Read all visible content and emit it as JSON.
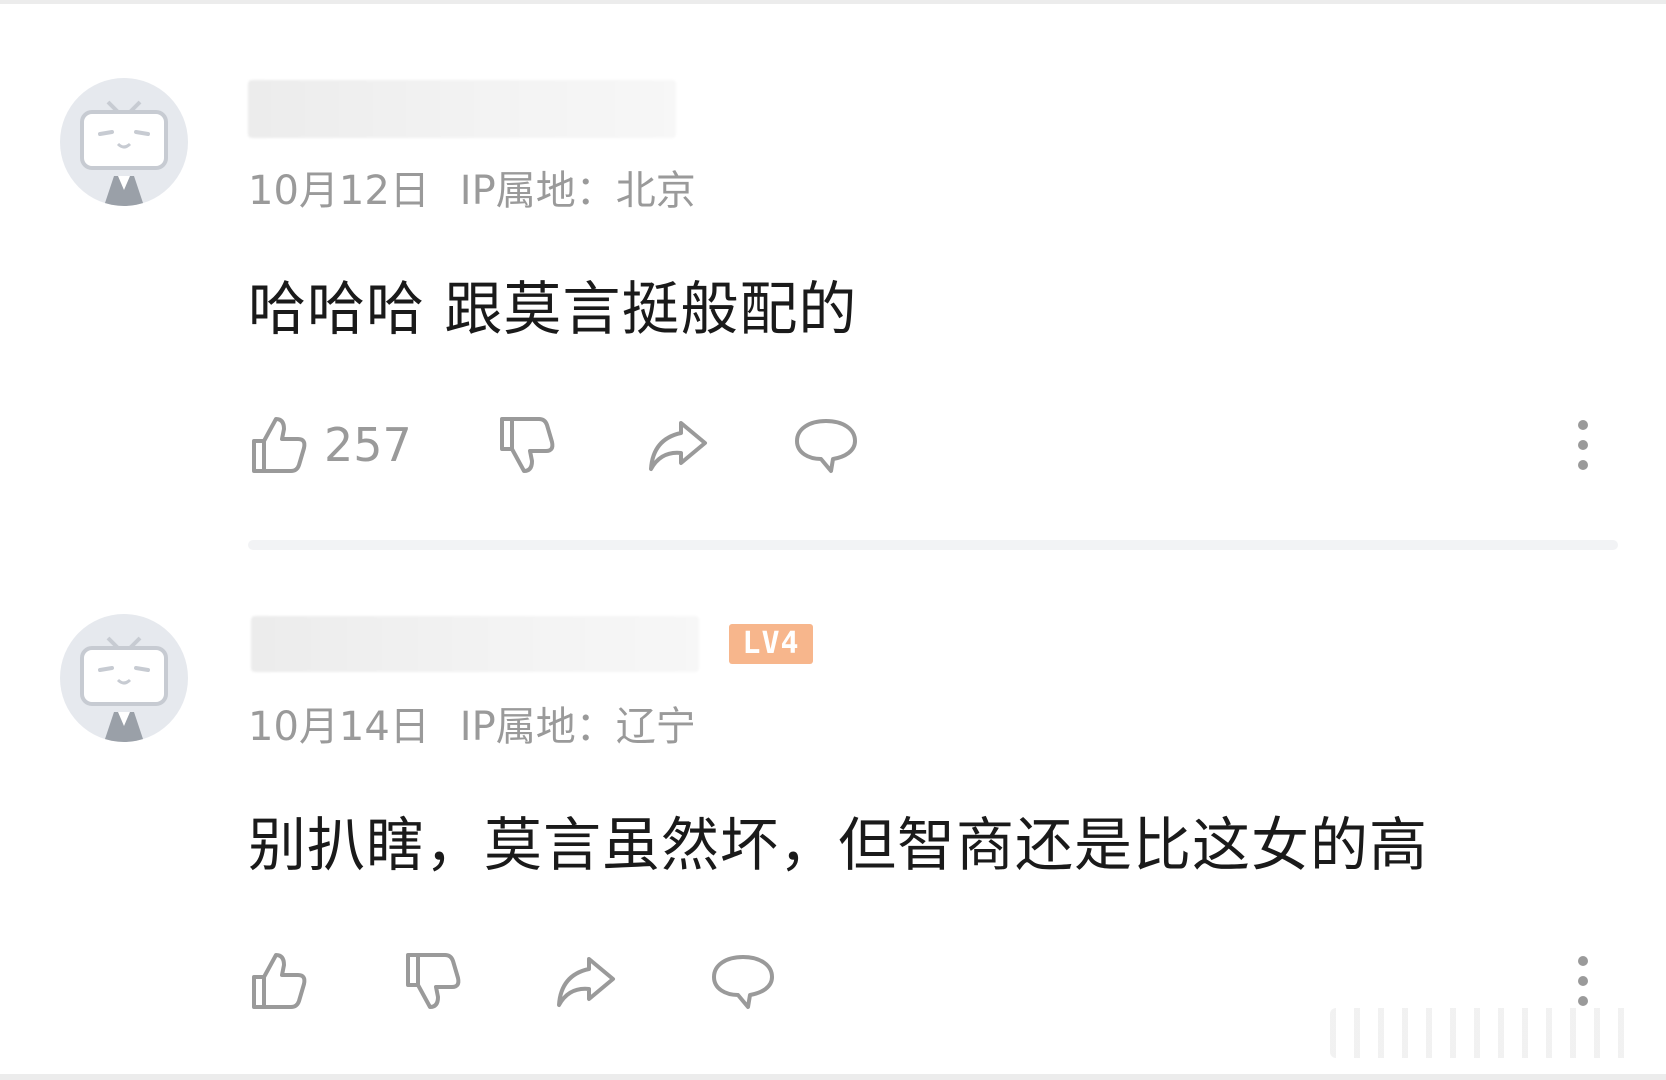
{
  "comments": [
    {
      "date": "10月12日",
      "ip_location": "IP属地：北京",
      "text": "哈哈哈 跟莫言挺般配的",
      "like_count": "257"
    },
    {
      "level_badge": "LV4",
      "date": "10月14日",
      "ip_location": "IP属地：辽宁",
      "text": "别扒瞎，莫言虽然坏，但智商还是比这女的高",
      "like_count": ""
    }
  ],
  "icons": {
    "like": "thumbs-up-icon",
    "dislike": "thumbs-down-icon",
    "share": "share-icon",
    "reply": "reply-icon",
    "more": "more-icon"
  },
  "colors": {
    "text": "#1a1a1a",
    "meta": "#9a9a9a",
    "badge": "#f7b68c",
    "avatar_bg": "#e6e9ee"
  }
}
